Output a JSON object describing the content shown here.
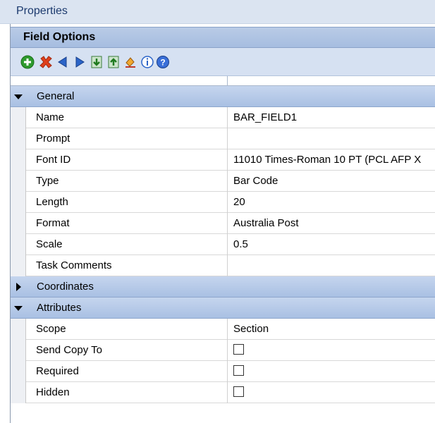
{
  "window": {
    "title": "Properties"
  },
  "header": {
    "title": "Field Options"
  },
  "toolbar": {
    "buttons": [
      {
        "icon": "add-icon"
      },
      {
        "icon": "delete-icon"
      },
      {
        "icon": "previous-icon"
      },
      {
        "icon": "next-icon"
      },
      {
        "icon": "move-down-icon"
      },
      {
        "icon": "move-up-icon"
      },
      {
        "icon": "fill-icon"
      },
      {
        "icon": "info-icon"
      },
      {
        "icon": "help-icon"
      }
    ]
  },
  "categories": {
    "general": {
      "label": "General",
      "expanded": true,
      "rows": [
        {
          "name": "Name",
          "value": "BAR_FIELD1"
        },
        {
          "name": "Prompt",
          "value": ""
        },
        {
          "name": "Font ID",
          "value": "11010 Times-Roman 10 PT (PCL AFP X"
        },
        {
          "name": "Type",
          "value": "Bar Code"
        },
        {
          "name": "Length",
          "value": "20"
        },
        {
          "name": "Format",
          "value": "Australia Post"
        },
        {
          "name": "Scale",
          "value": "0.5"
        },
        {
          "name": "Task Comments",
          "value": ""
        }
      ]
    },
    "coordinates": {
      "label": "Coordinates",
      "expanded": false
    },
    "attributes": {
      "label": "Attributes",
      "expanded": true,
      "rows": [
        {
          "name": "Scope",
          "value": "Section"
        },
        {
          "name": "Send Copy To",
          "checked": false
        },
        {
          "name": "Required",
          "checked": false
        },
        {
          "name": "Hidden",
          "checked": false
        }
      ]
    }
  }
}
